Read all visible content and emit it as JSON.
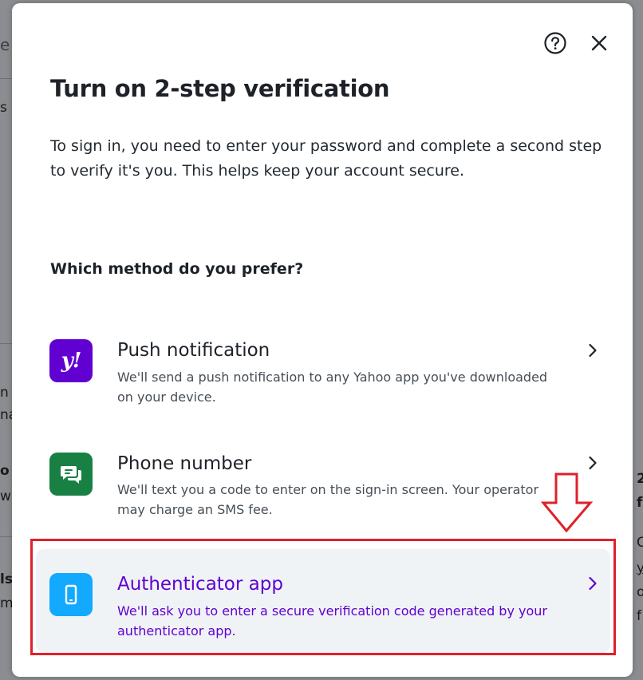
{
  "background_fragments": [
    "e",
    "s",
    "n v",
    "na",
    "o",
    "w",
    "ls",
    "m",
    "2",
    "f",
    "C",
    "y",
    "o",
    "f"
  ],
  "dialog": {
    "help_icon": "help-circle-icon",
    "close_icon": "close-icon",
    "title": "Turn on 2-step verification",
    "description": "To sign in, you need to enter your password and complete a second step to verify it's you. This helps keep your account secure.",
    "question": "Which method do you prefer?",
    "methods": [
      {
        "title": "Push notification",
        "description": "We'll send a push notification to any Yahoo app you've downloaded on your device.",
        "icon": "yahoo-logo-icon",
        "badge_color": "#6001d2"
      },
      {
        "title": "Phone number",
        "description": "We'll text you a code to enter on the sign-in screen. Your operator may charge an SMS fee.",
        "icon": "chat-bubbles-icon",
        "badge_color": "#188042"
      },
      {
        "title": "Authenticator app",
        "description": "We'll ask you to enter a secure verification code generated by your authenticator app.",
        "icon": "mobile-phone-icon",
        "badge_color": "#12a9ff",
        "highlighted": true
      }
    ]
  },
  "colors": {
    "accent": "#6001d2",
    "annotation": "#e0202a",
    "highlight_bg": "#f0f3f5"
  },
  "logo_text": "y!"
}
